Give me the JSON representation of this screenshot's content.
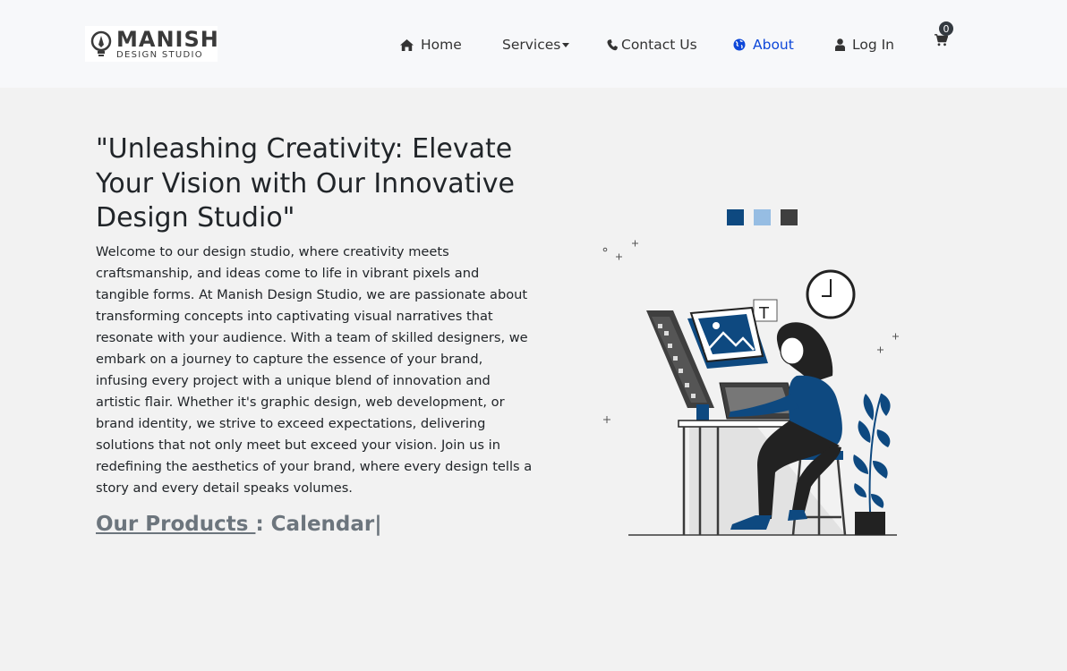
{
  "brand": {
    "name_main": "MANISH",
    "name_sub": "DESIGN STUDIO",
    "icon": "lightbulb-pen-icon"
  },
  "nav": {
    "items": [
      {
        "label": "Home",
        "icon": "home-icon"
      },
      {
        "label": "Services",
        "icon": "caret-down-icon"
      },
      {
        "label": "Contact Us",
        "icon": "phone-icon"
      },
      {
        "label": "About",
        "icon": "globe-icon",
        "active": true
      },
      {
        "label": "Log In",
        "icon": "user-icon"
      }
    ],
    "cart": {
      "count": "0",
      "icon": "cart-icon"
    },
    "active_color": "#0d47d9"
  },
  "hero": {
    "title": "\"Unleashing Creativity: Elevate Your Vision with Our Innovative Design Studio\"",
    "paragraph": "Welcome to our design studio, where creativity meets craftsmanship, and ideas come to life in vibrant pixels and tangible forms. At Manish Design Studio, we are passionate about transforming concepts into captivating visual narratives that resonate with your audience. With a team of skilled designers, we embark on a journey to capture the essence of your brand, infusing every project with a unique blend of innovation and artistic flair. Whether it's graphic design, web development, or brand identity, we strive to exceed expectations, delivering solutions that not only meet but exceed your vision. Join us in redefining the aesthetics of your brand, where every design tells a story and every detail speaks volumes.",
    "products_link": "Our Products ",
    "products_separator": ": ",
    "products_typed": "Calendar|"
  },
  "illustration": {
    "subject": "designer-at-desk-illustration",
    "colors": {
      "dark_blue": "#0e4980",
      "light_blue": "#96bde3",
      "dark_gray": "#3f3f3f"
    }
  }
}
